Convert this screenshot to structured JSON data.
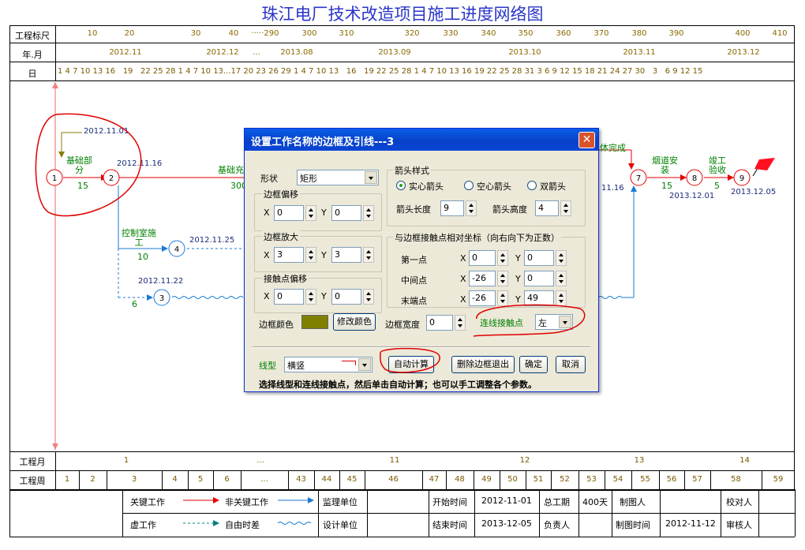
{
  "title": "珠江电厂技术改造项目施工进度网络图",
  "header_rows": {
    "scale_label": "工程标尺",
    "month_label": "年.月",
    "day_label": "日",
    "scale_ticks": [
      "10",
      "20",
      "30",
      "40",
      "·····290",
      "300",
      "310",
      "320",
      "330",
      "340",
      "350",
      "360",
      "370",
      "380",
      "390",
      "400",
      "410"
    ],
    "months": [
      "2012.11",
      "2012.12",
      "...",
      "2013.08",
      "2013.09",
      "2013.10",
      "2013.11",
      "2013.12"
    ],
    "days_text": "1 4 7 10 13 16   19   22 25 28 1 4 7 10 13...17 20 23 26 29 1 4 7 10 13   16   19 22 25 28 1 4 7 10 13 16 19 22 25 28 31 3 6 9 12 15 18 21 24 27 30   3   6 9 12 15"
  },
  "network": {
    "nodes": [
      "1",
      "2",
      "3",
      "4",
      "7",
      "8",
      "9"
    ],
    "labels": {
      "jichu_a": "基础部\n分",
      "jichu_a_dur": "15",
      "date_1": "2012.11.01",
      "date_2": "2012.11.16",
      "jichu_b": "基础充",
      "jichu_b_dur": "300",
      "kongzhi": "控制室施\n工",
      "kongzhi_dur": "10",
      "date_4": "2012.11.25",
      "date_3": "2012.11.22",
      "dur_3": "6",
      "wancheng": "体完成",
      "date_7": "11.16",
      "yandao": "烟道安\n装",
      "yandao_dur": "15",
      "date_8": "2013.12.01",
      "jungong": "竣工\n验收",
      "jungong_dur": "5",
      "date_9": "2013.12.05"
    }
  },
  "footer_rows": {
    "month_label": "工程月",
    "week_label": "工程周",
    "month_cells": [
      "1",
      "...",
      "11",
      "12",
      "13",
      "14"
    ],
    "week_cells": [
      "1",
      "2",
      "3",
      "4",
      "5",
      "6",
      "...",
      "43",
      "44",
      "45",
      "46",
      "47",
      "48",
      "49",
      "50",
      "51",
      "52",
      "53",
      "54",
      "55",
      "56",
      "57",
      "58",
      "59"
    ]
  },
  "legend": {
    "critical": "关键工作",
    "noncritical": "非关键工作",
    "supervisor": "监理单位",
    "start_time_label": "开始时间",
    "start_time": "2012-11-01",
    "total_period_label": "总工期",
    "total_period": "400天",
    "drawer_label": "制图人",
    "checker_label": "校对人",
    "virtual": "虚工作",
    "free_float": "自由时差",
    "designer": "设计单位",
    "end_time_label": "结束时间",
    "end_time": "2013-12-05",
    "owner_label": "负责人",
    "draw_time_label": "制图时间",
    "draw_time": "2012-11-12",
    "reviewer_label": "审核人"
  },
  "dialog": {
    "title": "设置工作名称的边框及引线---3",
    "shape_label": "形状",
    "shape_value": "矩形",
    "offset_group": "边框偏移",
    "offset_x": "0",
    "offset_y": "0",
    "enlarge_group": "边框放大",
    "enlarge_x": "3",
    "enlarge_y": "3",
    "contact_group": "接触点偏移",
    "contact_x": "0",
    "contact_y": "0",
    "x_label": "X",
    "y_label": "Y",
    "arrow_group": "箭头样式",
    "solid_arrow": "实心箭头",
    "hollow_arrow": "空心箭头",
    "double_arrow": "双箭头",
    "arrow_length_label": "箭头长度",
    "arrow_length": "9",
    "arrow_height_label": "箭头高度",
    "arrow_height": "4",
    "coord_group": "与边框接触点相对坐标（向右向下为正数）",
    "first_point": "第一点",
    "first_x": "0",
    "first_y": "0",
    "mid_point": "中间点",
    "mid_x": "-26",
    "mid_y": "0",
    "end_point": "末端点",
    "end_x": "-26",
    "end_y": "49",
    "border_color_label": "边框颜色",
    "border_color": "#808000",
    "modify_color": "修改颜色",
    "border_width_label": "边框宽度",
    "border_width": "0",
    "contact_label": "连线接触点",
    "contact_value": "左",
    "line_type_label": "线型",
    "line_type_value": "横竖",
    "auto_calc": "自动计算",
    "delete_exit": "删除边框退出",
    "ok": "确定",
    "cancel": "取消",
    "hint": "选择线型和连线接触点，然后单击自动计算；也可以手工调整各个参数。"
  }
}
